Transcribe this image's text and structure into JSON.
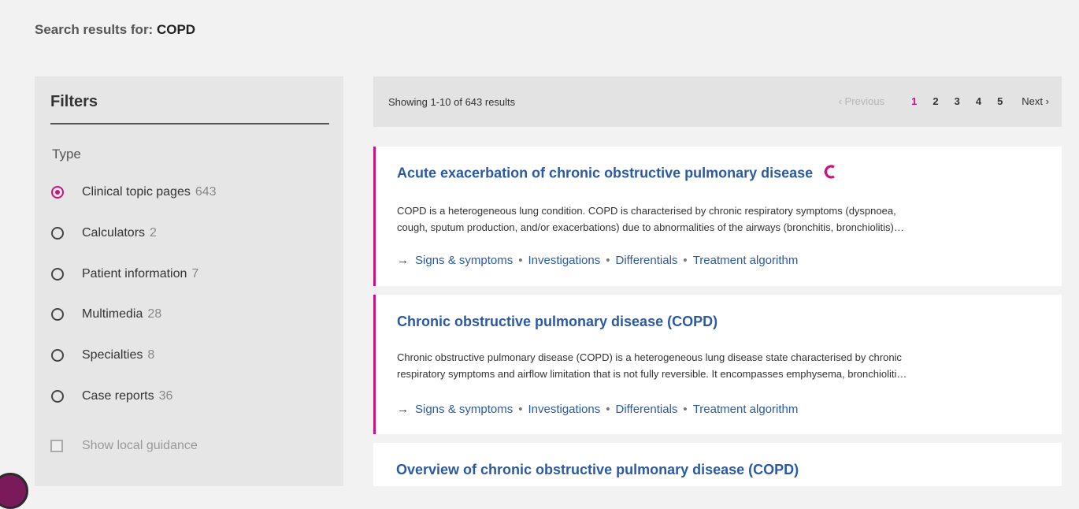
{
  "search": {
    "prefix": "Search results for:",
    "term": "COPD"
  },
  "filters": {
    "title": "Filters",
    "type_label": "Type",
    "options": [
      {
        "label": "Clinical topic pages",
        "count": "643",
        "selected": true
      },
      {
        "label": "Calculators",
        "count": "2",
        "selected": false
      },
      {
        "label": "Patient information",
        "count": "7",
        "selected": false
      },
      {
        "label": "Multimedia",
        "count": "28",
        "selected": false
      },
      {
        "label": "Specialties",
        "count": "8",
        "selected": false
      },
      {
        "label": "Case reports",
        "count": "36",
        "selected": false
      }
    ],
    "local_guidance_label": "Show local guidance"
  },
  "pagination": {
    "showing": "Showing 1-10 of 643 results",
    "previous": "Previous",
    "pages": [
      "1",
      "2",
      "3",
      "4",
      "5"
    ],
    "current": "1",
    "next": "Next"
  },
  "results": [
    {
      "title": "Acute exacerbation of chronic obstructive pulmonary disease",
      "desc_line1": "COPD is a heterogeneous lung condition. COPD is characterised by chronic respiratory symptoms (dyspnoea,",
      "desc_line2": "cough, sputum production, and/or exacerbations) due to abnormalities of the airways (bronchitis, bronchiolitis)…",
      "links": [
        "Signs & symptoms",
        "Investigations",
        "Differentials",
        "Treatment algorithm"
      ]
    },
    {
      "title": "Chronic obstructive pulmonary disease (COPD)",
      "desc_line1": "Chronic obstructive pulmonary disease (COPD) is a heterogeneous lung disease state characterised by chronic",
      "desc_line2": "respiratory symptoms and airflow limitation that is not fully reversible. It encompasses emphysema, bronchioliti…",
      "links": [
        "Signs & symptoms",
        "Investigations",
        "Differentials",
        "Treatment algorithm"
      ]
    },
    {
      "title": "Overview of chronic obstructive pulmonary disease (COPD)"
    }
  ],
  "colors": {
    "accent": "#c8157e",
    "link": "#2c5aa0"
  },
  "icons": {
    "arrow": "→",
    "next_chevron": "›",
    "prev_chevron": "‹",
    "separator": "•"
  }
}
